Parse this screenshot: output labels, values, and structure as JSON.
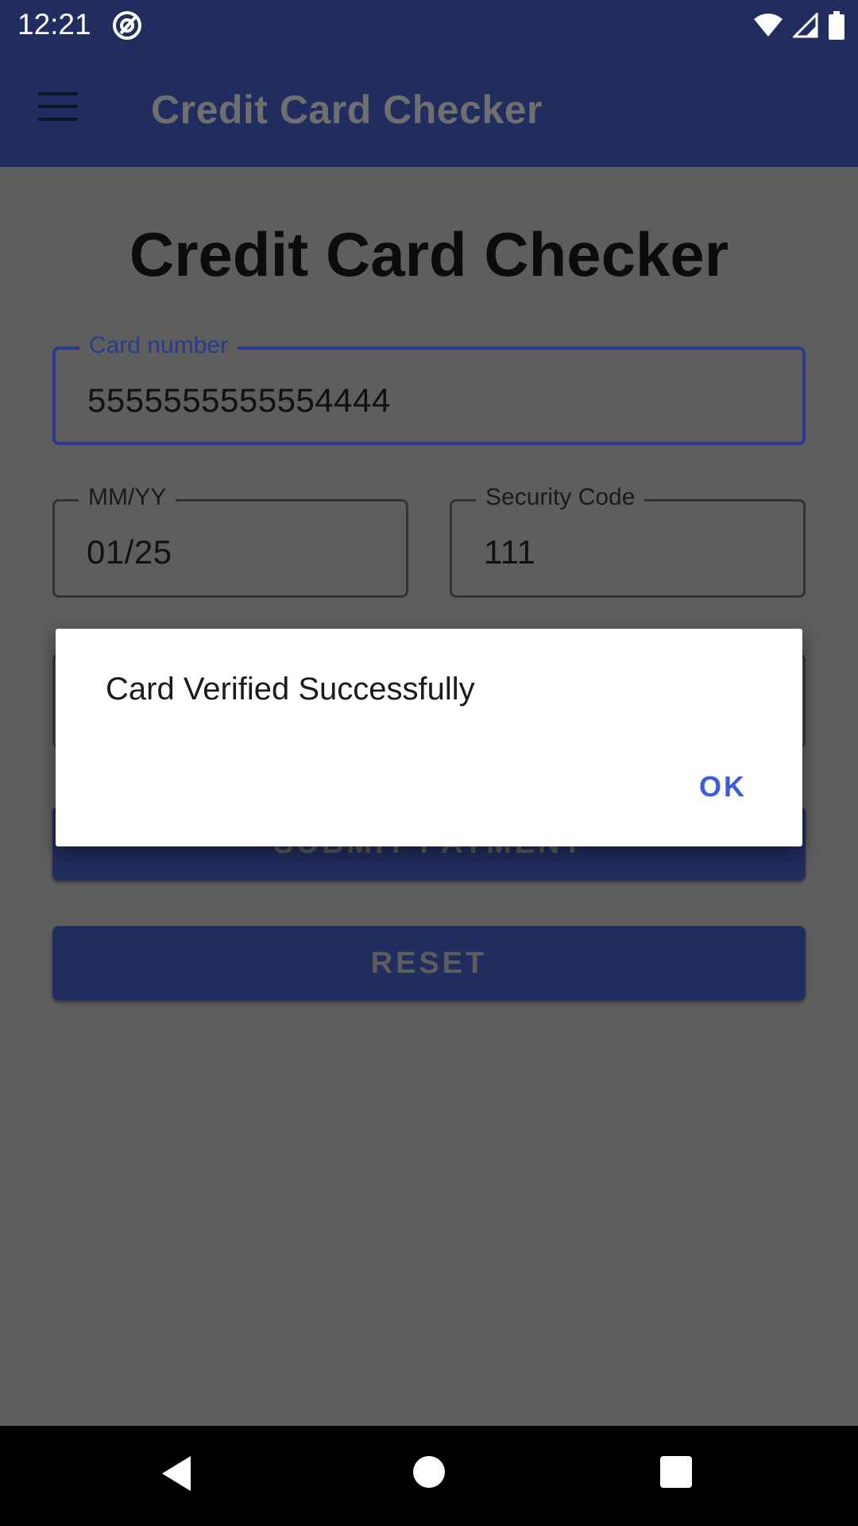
{
  "status_bar": {
    "time": "12:21",
    "icons": [
      "at-sign-icon",
      "wifi-icon",
      "cell-signal-icon",
      "battery-icon"
    ]
  },
  "app_bar": {
    "title": "Credit Card Checker",
    "menu_icon": "hamburger-menu-icon"
  },
  "page": {
    "title": "Credit Card Checker"
  },
  "form": {
    "card_number": {
      "label": "Card number",
      "value": "5555555555554444"
    },
    "expiry": {
      "label": "MM/YY",
      "value": "01/25"
    },
    "security_code": {
      "label": "Security Code",
      "value": "111"
    },
    "submit_label": "SUBMIT PAYMENT",
    "reset_label": "RESET"
  },
  "dialog": {
    "message": "Card Verified Successfully",
    "ok_label": "OK"
  },
  "colors": {
    "primary": "#222d5f",
    "accent": "#3d5be0",
    "scrim_background": "#5f5e5f"
  }
}
